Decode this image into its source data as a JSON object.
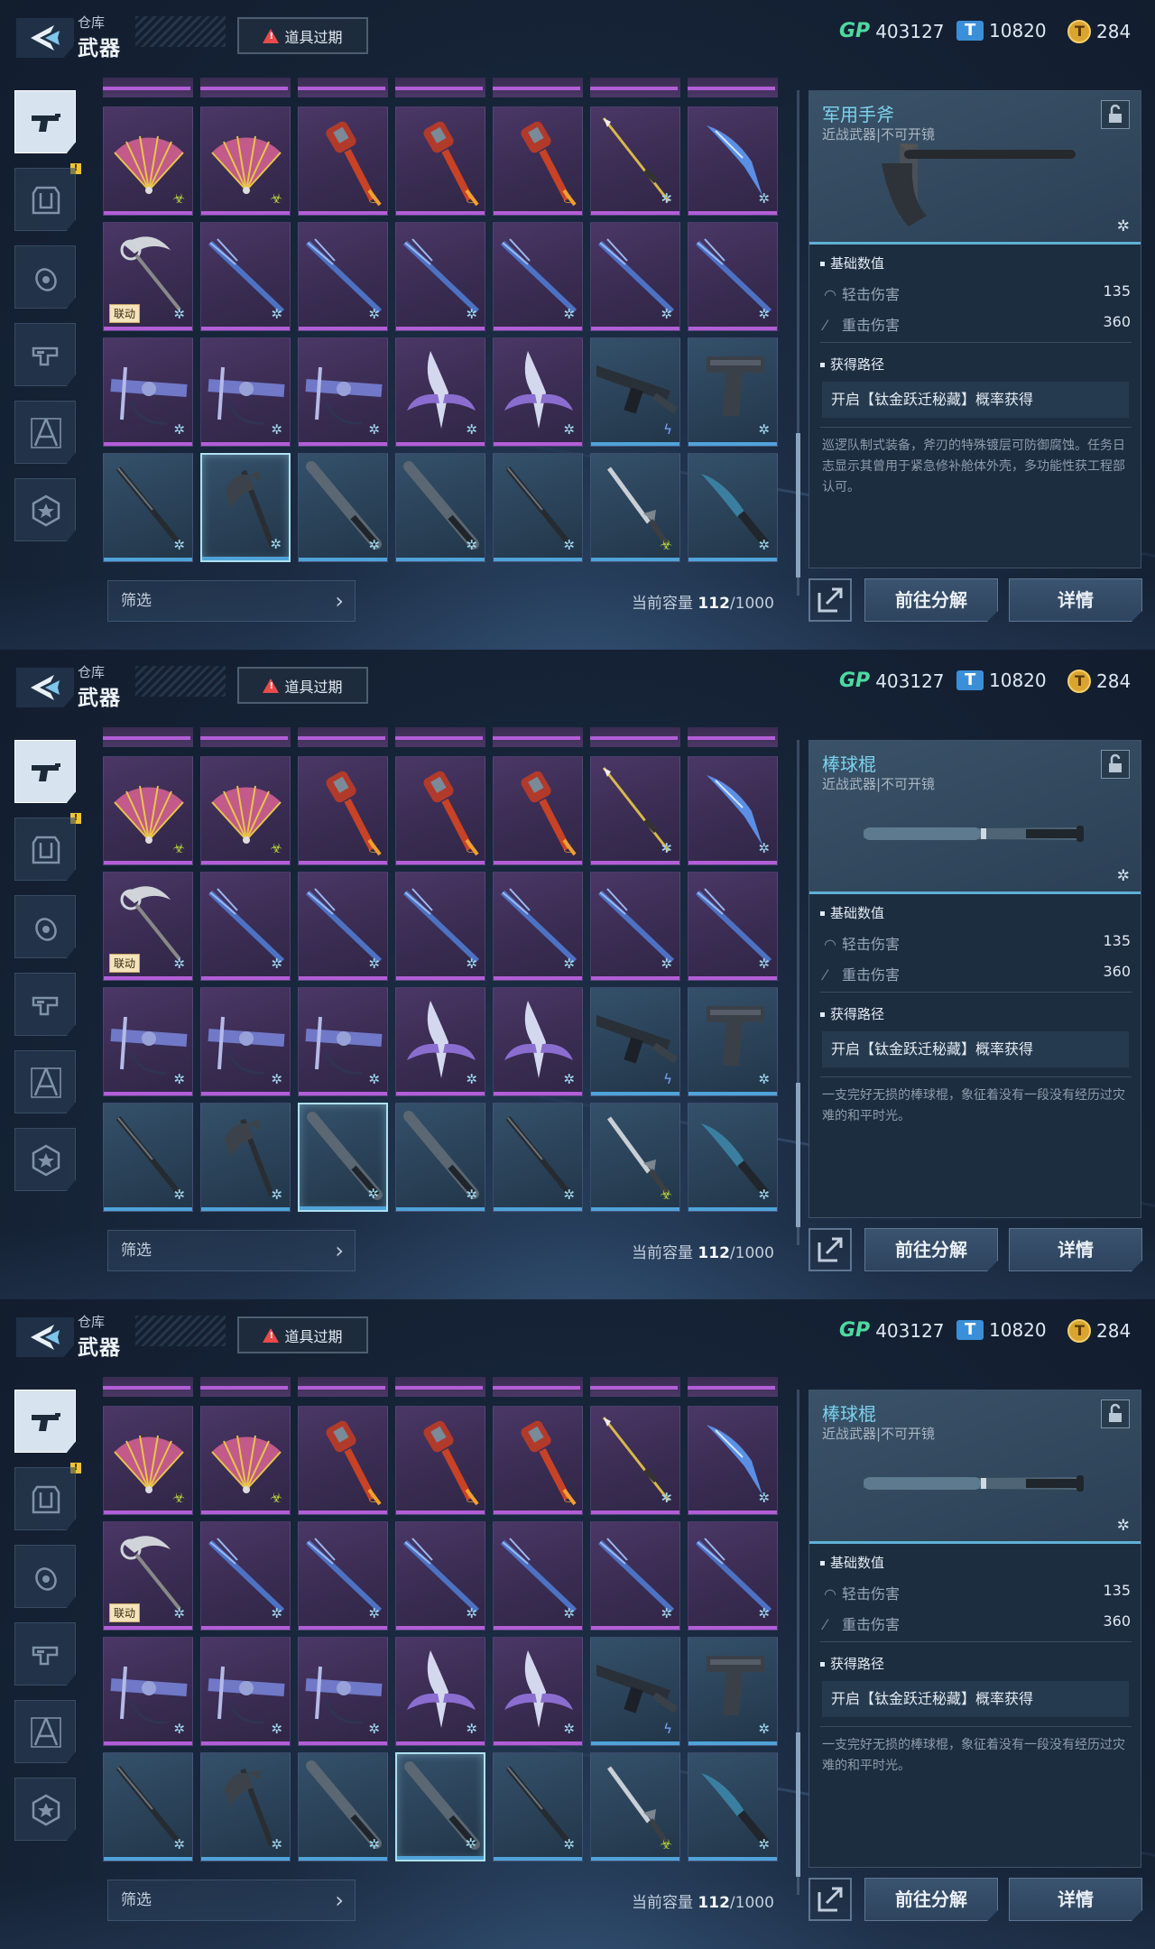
{
  "frames": [
    {
      "header": {
        "title_small": "仓库",
        "title": "武器",
        "expire_label": "道具过期"
      },
      "currency": {
        "gp": "403127",
        "tickets": "10820",
        "gold": "284"
      },
      "bottom": {
        "filter_label": "筛选",
        "capacity_label": "当前容量",
        "capacity_used": "112",
        "capacity_max": "/1000",
        "decompose_label": "前往分解",
        "details_label": "详情"
      },
      "detail": {
        "name": "军用手斧",
        "subtitle": "近战武器|不可开镜",
        "section_stats": "基础数值",
        "light_label": "轻击伤害",
        "light_value": "135",
        "heavy_label": "重击伤害",
        "heavy_value": "360",
        "section_source": "获得路径",
        "source": "开启【钛金跃迁秘藏】概率获得",
        "description": "巡逻队制式装备，斧刃的特殊镀层可防御腐蚀。任务日志显示其曾用于紧急修补舱体外壳，多功能性获工程部认可。"
      }
    },
    {
      "header": {
        "title_small": "仓库",
        "title": "武器",
        "expire_label": "道具过期"
      },
      "currency": {
        "gp": "403127",
        "tickets": "10820",
        "gold": "284"
      },
      "bottom": {
        "filter_label": "筛选",
        "capacity_label": "当前容量",
        "capacity_used": "112",
        "capacity_max": "/1000",
        "decompose_label": "前往分解",
        "details_label": "详情"
      },
      "detail": {
        "name": "棒球棍",
        "subtitle": "近战武器|不可开镜",
        "section_stats": "基础数值",
        "light_label": "轻击伤害",
        "light_value": "135",
        "heavy_label": "重击伤害",
        "heavy_value": "360",
        "section_source": "获得路径",
        "source": "开启【钛金跃迁秘藏】概率获得",
        "description": "一支完好无损的棒球棍，象征着没有一段没有经历过灾难的和平时光。"
      }
    },
    {
      "header": {
        "title_small": "仓库",
        "title": "武器",
        "expire_label": "道具过期"
      },
      "currency": {
        "gp": "403127",
        "tickets": "10820",
        "gold": "284"
      },
      "bottom": {
        "filter_label": "筛选",
        "capacity_label": "当前容量",
        "capacity_used": "112",
        "capacity_max": "/1000",
        "decompose_label": "前往分解",
        "details_label": "详情"
      },
      "detail": {
        "name": "棒球棍",
        "subtitle": "近战武器|不可开镜",
        "section_stats": "基础数值",
        "light_label": "轻击伤害",
        "light_value": "135",
        "heavy_label": "重击伤害",
        "heavy_value": "360",
        "section_source": "获得路径",
        "source": "开启【钛金跃迁秘藏】概率获得",
        "description": "一支完好无损的棒球棍，象征着没有一段没有经历过灾难的和平时光。"
      }
    }
  ],
  "selected_cell": [
    "r3c1",
    "r3c2",
    "r3c3"
  ],
  "grid": {
    "collab_tag": "联动",
    "rows": [
      [
        {
          "icon": "pink-fan-icon",
          "ele": "poison",
          "rar": "purple"
        },
        {
          "icon": "pink-fan-icon",
          "ele": "poison",
          "rar": "purple"
        },
        {
          "icon": "red-torch-club-icon",
          "ele": "fire",
          "rar": "purple"
        },
        {
          "icon": "red-torch-club-icon",
          "ele": "fire",
          "rar": "purple"
        },
        {
          "icon": "red-torch-club-icon",
          "ele": "fire",
          "rar": "purple"
        },
        {
          "icon": "gold-spear-icon",
          "ele": "frost",
          "rar": "purple"
        },
        {
          "icon": "blue-blade-icon",
          "ele": "frost",
          "rar": "purple"
        }
      ],
      [
        {
          "icon": "scythe-icon",
          "ele": "frost",
          "rar": "purple",
          "collab": true
        },
        {
          "icon": "blue-lance-icon",
          "ele": "frost",
          "rar": "purple"
        },
        {
          "icon": "blue-lance-icon",
          "ele": "frost",
          "rar": "purple"
        },
        {
          "icon": "blue-lance-icon",
          "ele": "frost",
          "rar": "purple"
        },
        {
          "icon": "blue-lance-icon",
          "ele": "frost",
          "rar": "purple"
        },
        {
          "icon": "blue-lance-icon",
          "ele": "frost",
          "rar": "purple"
        },
        {
          "icon": "blue-lance-icon",
          "ele": "frost",
          "rar": "purple"
        }
      ],
      [
        {
          "icon": "crossbow-icon",
          "ele": "frost",
          "rar": "purple"
        },
        {
          "icon": "crossbow-icon",
          "ele": "frost",
          "rar": "purple"
        },
        {
          "icon": "crossbow-icon",
          "ele": "frost",
          "rar": "purple"
        },
        {
          "icon": "winged-blade-icon",
          "ele": "frost",
          "rar": "purple"
        },
        {
          "icon": "winged-blade-icon",
          "ele": "frost",
          "rar": "purple"
        },
        {
          "icon": "shotgun-icon",
          "ele": "shock",
          "rar": "blue"
        },
        {
          "icon": "pistol-icon",
          "ele": "frost",
          "rar": "blue"
        }
      ],
      [
        {
          "icon": "katana-icon",
          "ele": "frost",
          "rar": "blue"
        },
        {
          "icon": "hatchet-icon",
          "ele": "frost",
          "rar": "blue"
        },
        {
          "icon": "bat-icon",
          "ele": "frost",
          "rar": "blue"
        },
        {
          "icon": "bat-icon",
          "ele": "frost",
          "rar": "blue"
        },
        {
          "icon": "katana-icon",
          "ele": "frost",
          "rar": "blue"
        },
        {
          "icon": "dagger-icon",
          "ele": "poison",
          "rar": "blue"
        },
        {
          "icon": "combat-knife-icon",
          "ele": "frost",
          "rar": "blue"
        }
      ]
    ]
  },
  "element_glyphs": {
    "frost": "✲",
    "fire": "♨",
    "poison": "☣",
    "shock": "ϟ"
  },
  "element_colors": {
    "frost": "#9fd6ee",
    "fire": "#f0a030",
    "poison": "#b6d63a",
    "shock": "#7aa6ff"
  },
  "panel_weapons": [
    "hatchet-icon",
    "bat-icon",
    "bat-icon"
  ]
}
